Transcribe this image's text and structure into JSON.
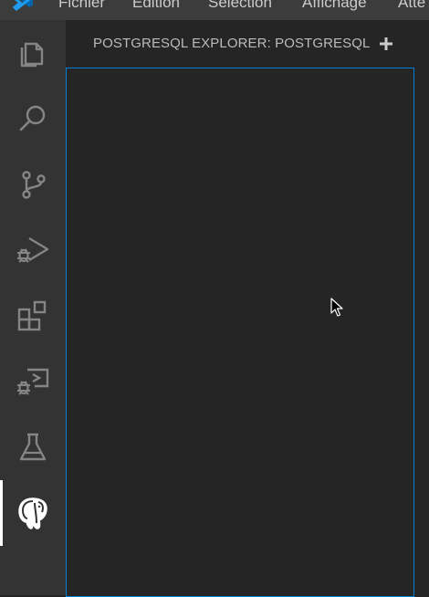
{
  "menu": {
    "items": [
      {
        "label": "Fichier"
      },
      {
        "label": "Edition"
      },
      {
        "label": "Sélection"
      },
      {
        "label": "Affichage"
      },
      {
        "label": "Atte"
      }
    ]
  },
  "activity_bar": {
    "items": [
      {
        "icon": "files-icon",
        "active": false
      },
      {
        "icon": "search-icon",
        "active": false
      },
      {
        "icon": "source-control-icon",
        "active": false
      },
      {
        "icon": "run-debug-icon",
        "active": false
      },
      {
        "icon": "extensions-icon",
        "active": false
      },
      {
        "icon": "remote-debug-icon",
        "active": false
      },
      {
        "icon": "testing-flask-icon",
        "active": false
      },
      {
        "icon": "postgresql-elephant-icon",
        "active": true
      }
    ]
  },
  "sidebar": {
    "title": "POSTGRESQL EXPLORER: POSTGRESQL",
    "add_icon": "plus-icon"
  },
  "colors": {
    "titlebar": "#3c3c3c",
    "activity_bar": "#333333",
    "sidebar": "#252526",
    "focus_border": "#007fd4",
    "icon": "#858585",
    "active_icon": "#ffffff"
  }
}
